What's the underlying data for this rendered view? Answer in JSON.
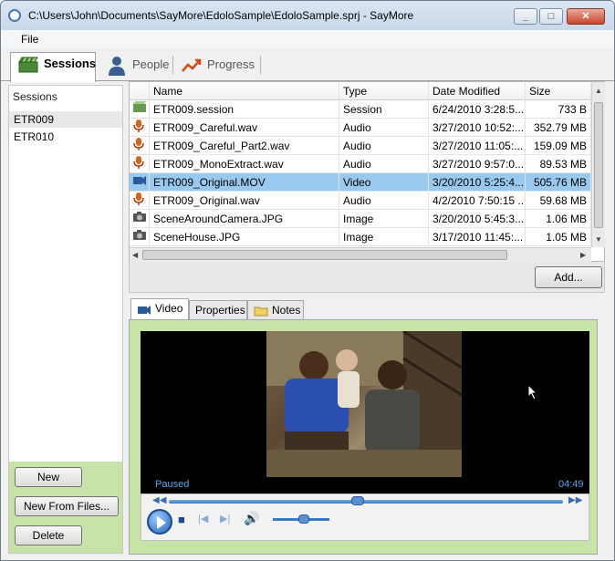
{
  "window": {
    "title": "C:\\Users\\John\\Documents\\SayMore\\EdoloSample\\EdoloSample.sprj - SayMore"
  },
  "menu": {
    "file": "File"
  },
  "main_tabs": [
    {
      "label": "Sessions",
      "icon": "clapperboard-icon",
      "active": true
    },
    {
      "label": "People",
      "icon": "person-icon",
      "active": false
    },
    {
      "label": "Progress",
      "icon": "chart-trend-icon",
      "active": false
    }
  ],
  "sessions_pane": {
    "header": "Sessions",
    "items": [
      "ETR009",
      "ETR010"
    ],
    "selected": "ETR009",
    "buttons": {
      "new": "New",
      "new_from_files": "New From Files...",
      "delete": "Delete"
    }
  },
  "file_table": {
    "columns": [
      "Name",
      "Type",
      "Date Modified",
      "Size"
    ],
    "rows": [
      {
        "icon": "session-icon",
        "name": "ETR009.session",
        "type": "Session",
        "date": "6/24/2010 3:28:5...",
        "size": "733 B",
        "selected": false
      },
      {
        "icon": "microphone-icon",
        "name": "ETR009_Careful.wav",
        "type": "Audio",
        "date": "3/27/2010 10:52:...",
        "size": "352.79 MB",
        "selected": false
      },
      {
        "icon": "microphone-icon",
        "name": "ETR009_Careful_Part2.wav",
        "type": "Audio",
        "date": "3/27/2010 11:05:...",
        "size": "159.09 MB",
        "selected": false
      },
      {
        "icon": "microphone-icon",
        "name": "ETR009_MonoExtract.wav",
        "type": "Audio",
        "date": "3/27/2010 9:57:0...",
        "size": "89.53 MB",
        "selected": false
      },
      {
        "icon": "video-camera-icon",
        "name": "ETR009_Original.MOV",
        "type": "Video",
        "date": "3/20/2010 5:25:4...",
        "size": "505.76 MB",
        "selected": true
      },
      {
        "icon": "microphone-icon",
        "name": "ETR009_Original.wav",
        "type": "Audio",
        "date": "4/2/2010 7:50:15 ...",
        "size": "59.68 MB",
        "selected": false
      },
      {
        "icon": "camera-icon",
        "name": "SceneAroundCamera.JPG",
        "type": "Image",
        "date": "3/20/2010 5:45:3...",
        "size": "1.06 MB",
        "selected": false
      },
      {
        "icon": "camera-icon",
        "name": "SceneHouse.JPG",
        "type": "Image",
        "date": "3/17/2010 11:45:...",
        "size": "1.05 MB",
        "selected": false
      }
    ],
    "add_button": "Add..."
  },
  "detail_tabs": [
    {
      "label": "Video",
      "icon": "video-camera-icon",
      "active": true
    },
    {
      "label": "Properties",
      "active": false
    },
    {
      "label": "Notes",
      "icon": "folder-icon",
      "active": false
    }
  ],
  "player": {
    "status": "Paused",
    "time": "04:49",
    "progress": 0.48,
    "volume": 0.55
  },
  "colors": {
    "selection": "#99c9ef",
    "panel_green": "#c8e3a8",
    "player_text": "#5aa8e8"
  }
}
